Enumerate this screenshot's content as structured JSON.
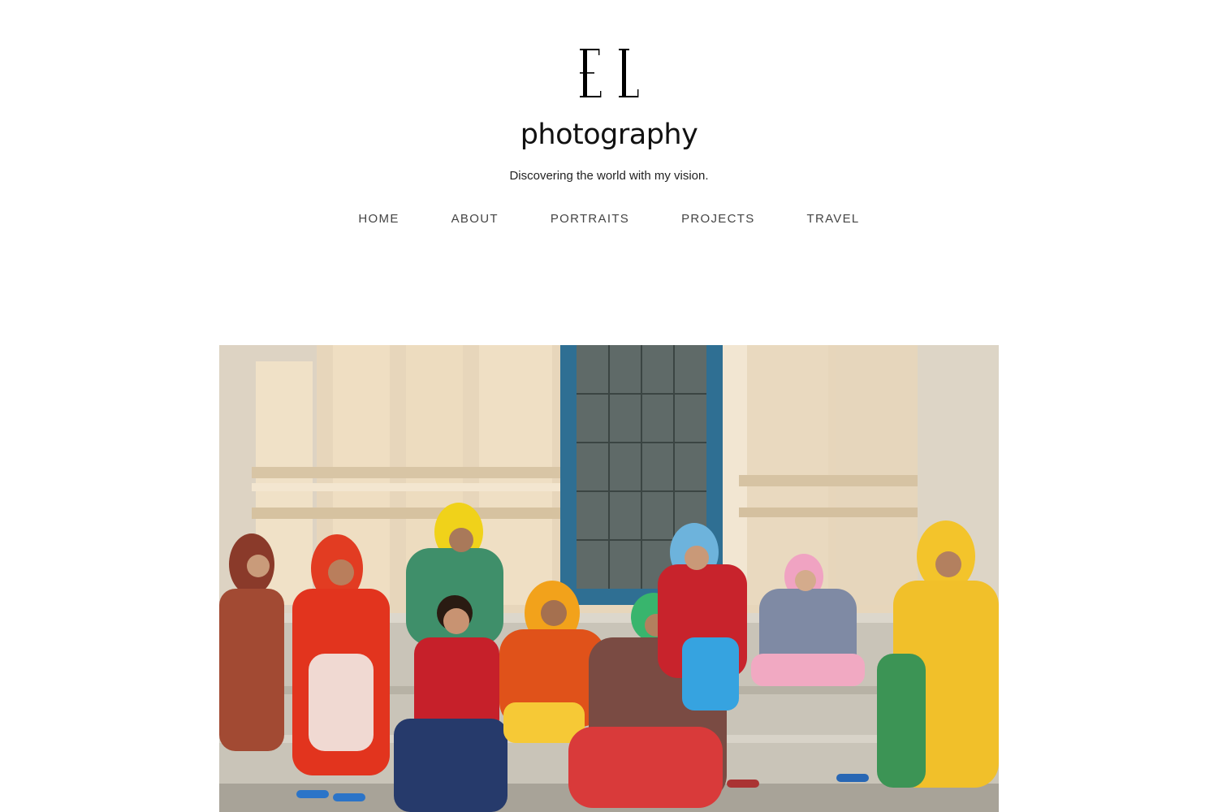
{
  "site": {
    "logo_text": "EL",
    "title": "photography",
    "tagline": "Discovering the world with my vision."
  },
  "nav": {
    "items": [
      {
        "label": "HOME"
      },
      {
        "label": "ABOUT"
      },
      {
        "label": "PORTRAITS"
      },
      {
        "label": "PROJECTS"
      },
      {
        "label": "TRAVEL"
      }
    ]
  },
  "hero": {
    "subject": "women in colorful saris sitting on temple steps"
  },
  "colors": {
    "text": "#111111",
    "nav_text": "#444444",
    "background": "#ffffff"
  }
}
